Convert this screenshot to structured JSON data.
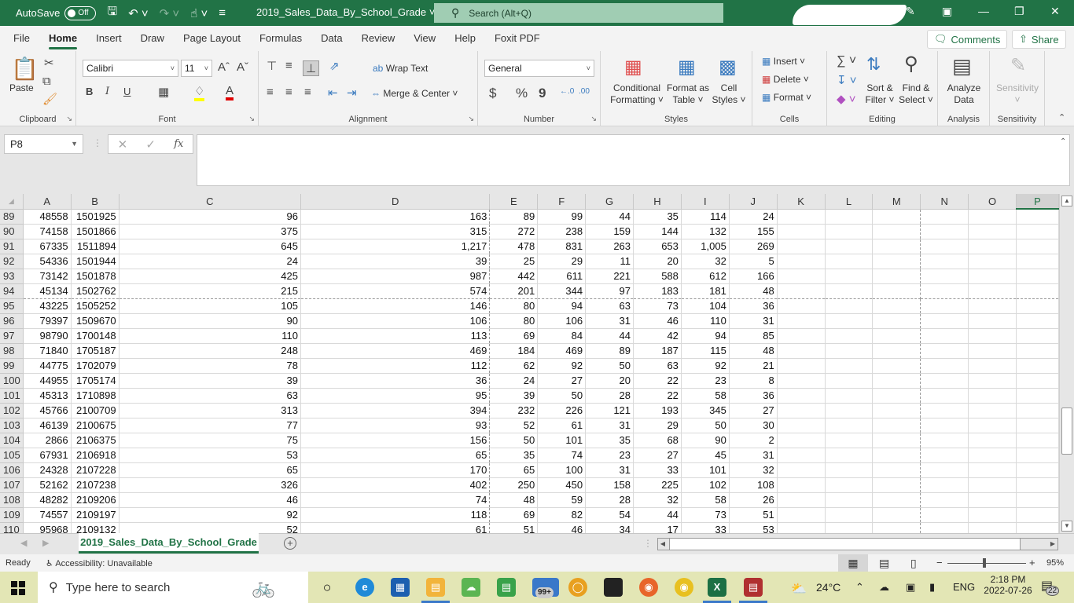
{
  "titlebar": {
    "autosave_label": "AutoSave",
    "autosave_state": "Off",
    "file_title": "2019_Sales_Data_By_School_Grade",
    "search_placeholder": "Search (Alt+Q)"
  },
  "menu": {
    "items": [
      "File",
      "Home",
      "Insert",
      "Draw",
      "Page Layout",
      "Formulas",
      "Data",
      "Review",
      "View",
      "Help",
      "Foxit PDF"
    ],
    "active": "Home",
    "comments_label": "Comments",
    "share_label": "Share"
  },
  "ribbon": {
    "clipboard": {
      "label": "Clipboard",
      "paste": "Paste"
    },
    "font": {
      "label": "Font",
      "font_name": "Calibri",
      "font_size": "11",
      "bold": "B",
      "italic": "I",
      "underline": "U"
    },
    "alignment": {
      "label": "Alignment",
      "wrap_text": "Wrap Text",
      "merge_center": "Merge & Center"
    },
    "number": {
      "label": "Number",
      "format": "General",
      "currency": "$",
      "percent": "%",
      "comma": "9"
    },
    "styles": {
      "label": "Styles",
      "conditional_line1": "Conditional",
      "conditional_line2": "Formatting",
      "format_table_line1": "Format as",
      "format_table_line2": "Table",
      "cell_styles_line1": "Cell",
      "cell_styles_line2": "Styles"
    },
    "cells": {
      "label": "Cells",
      "insert": "Insert",
      "delete": "Delete",
      "format": "Format"
    },
    "editing": {
      "label": "Editing",
      "sort_line1": "Sort &",
      "sort_line2": "Filter",
      "find_line1": "Find &",
      "find_line2": "Select"
    },
    "analysis": {
      "label": "Analysis",
      "analyze_line1": "Analyze",
      "analyze_line2": "Data"
    },
    "sensitivity": {
      "label": "Sensitivity",
      "button": "Sensitivity"
    }
  },
  "formula_bar": {
    "name_box": "P8",
    "formula": "",
    "fx": "fx"
  },
  "sheet": {
    "columns": [
      "A",
      "B",
      "C",
      "D",
      "E",
      "F",
      "G",
      "H",
      "I",
      "J",
      "K",
      "L",
      "M",
      "N",
      "O",
      "P"
    ],
    "selected_column": "P",
    "rows": [
      {
        "n": "89",
        "c": [
          "48558",
          "1501925",
          "96",
          "163",
          "89",
          "99",
          "44",
          "35",
          "114",
          "24"
        ]
      },
      {
        "n": "90",
        "c": [
          "74158",
          "1501866",
          "375",
          "315",
          "272",
          "238",
          "159",
          "144",
          "132",
          "155"
        ]
      },
      {
        "n": "91",
        "c": [
          "67335",
          "1511894",
          "645",
          "1,217",
          "478",
          "831",
          "263",
          "653",
          "1,005",
          "269"
        ]
      },
      {
        "n": "92",
        "c": [
          "54336",
          "1501944",
          "24",
          "39",
          "25",
          "29",
          "11",
          "20",
          "32",
          "5"
        ]
      },
      {
        "n": "93",
        "c": [
          "73142",
          "1501878",
          "425",
          "987",
          "442",
          "611",
          "221",
          "588",
          "612",
          "166"
        ]
      },
      {
        "n": "94",
        "c": [
          "45134",
          "1502762",
          "215",
          "574",
          "201",
          "344",
          "97",
          "183",
          "181",
          "48"
        ]
      },
      {
        "n": "95",
        "c": [
          "43225",
          "1505252",
          "105",
          "146",
          "80",
          "94",
          "63",
          "73",
          "104",
          "36"
        ]
      },
      {
        "n": "96",
        "c": [
          "79397",
          "1509670",
          "90",
          "106",
          "80",
          "106",
          "31",
          "46",
          "110",
          "31"
        ]
      },
      {
        "n": "97",
        "c": [
          "98790",
          "1700148",
          "110",
          "113",
          "69",
          "84",
          "44",
          "42",
          "94",
          "85"
        ]
      },
      {
        "n": "98",
        "c": [
          "71840",
          "1705187",
          "248",
          "469",
          "184",
          "469",
          "89",
          "187",
          "115",
          "48"
        ]
      },
      {
        "n": "99",
        "c": [
          "44775",
          "1702079",
          "78",
          "112",
          "62",
          "92",
          "50",
          "63",
          "92",
          "21"
        ]
      },
      {
        "n": "100",
        "c": [
          "44955",
          "1705174",
          "39",
          "36",
          "24",
          "27",
          "20",
          "22",
          "23",
          "8"
        ]
      },
      {
        "n": "101",
        "c": [
          "45313",
          "1710898",
          "63",
          "95",
          "39",
          "50",
          "28",
          "22",
          "58",
          "36"
        ]
      },
      {
        "n": "102",
        "c": [
          "45766",
          "2100709",
          "313",
          "394",
          "232",
          "226",
          "121",
          "193",
          "345",
          "27"
        ]
      },
      {
        "n": "103",
        "c": [
          "46139",
          "2100675",
          "77",
          "93",
          "52",
          "61",
          "31",
          "29",
          "50",
          "30"
        ]
      },
      {
        "n": "104",
        "c": [
          "2866",
          "2106375",
          "75",
          "156",
          "50",
          "101",
          "35",
          "68",
          "90",
          "2"
        ]
      },
      {
        "n": "105",
        "c": [
          "67931",
          "2106918",
          "53",
          "65",
          "35",
          "74",
          "23",
          "27",
          "45",
          "31"
        ]
      },
      {
        "n": "106",
        "c": [
          "24328",
          "2107228",
          "65",
          "170",
          "65",
          "100",
          "31",
          "33",
          "101",
          "32"
        ]
      },
      {
        "n": "107",
        "c": [
          "52162",
          "2107238",
          "326",
          "402",
          "250",
          "450",
          "158",
          "225",
          "102",
          "108"
        ]
      },
      {
        "n": "108",
        "c": [
          "48282",
          "2109206",
          "46",
          "74",
          "48",
          "59",
          "28",
          "32",
          "58",
          "26"
        ]
      },
      {
        "n": "109",
        "c": [
          "74557",
          "2109197",
          "92",
          "118",
          "69",
          "82",
          "54",
          "44",
          "73",
          "51"
        ]
      },
      {
        "n": "110",
        "c": [
          "95968",
          "2109132",
          "52",
          "61",
          "51",
          "46",
          "34",
          "17",
          "33",
          "53"
        ]
      }
    ],
    "tab_name": "2019_Sales_Data_By_School_Grade"
  },
  "status": {
    "ready": "Ready",
    "accessibility": "Accessibility: Unavailable",
    "zoom": "95%"
  },
  "taskbar": {
    "search_placeholder": "Type here to search",
    "mail_badge": "99+",
    "weather": "24°C",
    "language": "ENG",
    "time": "2:18 PM",
    "date": "2022-07-26",
    "notifications": "22"
  }
}
